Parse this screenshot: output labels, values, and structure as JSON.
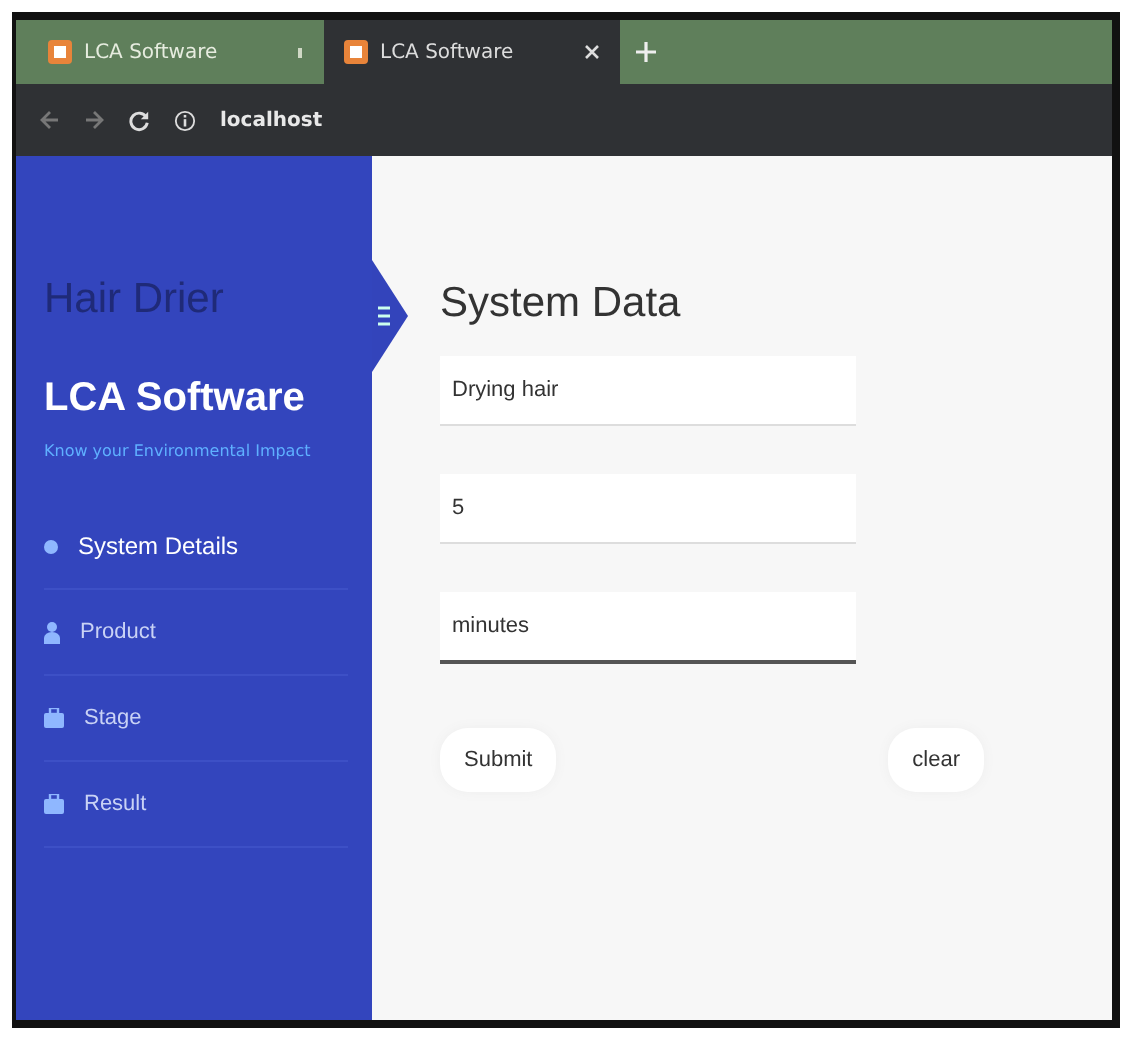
{
  "browser": {
    "tabs": [
      {
        "title": "LCA Software",
        "selected": false
      },
      {
        "title": "LCA Software",
        "selected": true
      }
    ],
    "address": "localhost"
  },
  "sidebar": {
    "project": "Hair Drier",
    "brand": "LCA Software",
    "tagline": "Know your Environmental Impact",
    "items": [
      {
        "label": "System Details",
        "kind": "dot",
        "selected": true
      },
      {
        "label": "Product",
        "kind": "person",
        "selected": false
      },
      {
        "label": "Stage",
        "kind": "case",
        "selected": false
      },
      {
        "label": "Result",
        "kind": "case",
        "selected": false
      }
    ]
  },
  "main": {
    "title": "System Data",
    "fields": [
      {
        "value": "Drying hair",
        "focused": false
      },
      {
        "value": "5",
        "focused": false
      },
      {
        "value": "minutes",
        "focused": true
      }
    ],
    "buttons": [
      "Submit",
      "clear"
    ]
  }
}
